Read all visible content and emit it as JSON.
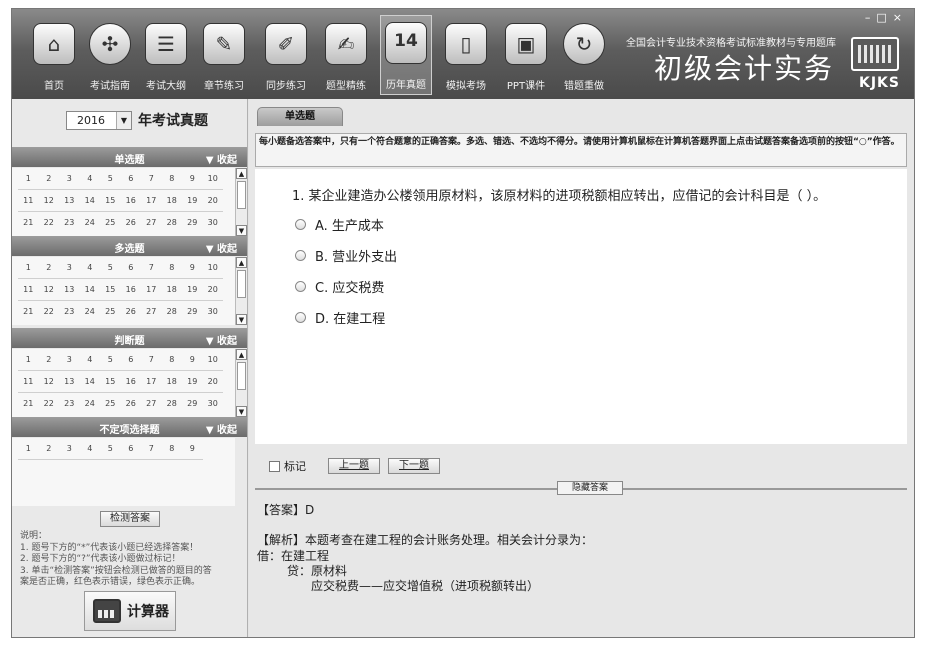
{
  "window": {
    "controls": [
      "–",
      "□",
      "×"
    ]
  },
  "toolbar": {
    "items": [
      {
        "label": "首页",
        "icon": "home-icon"
      },
      {
        "label": "考试指南",
        "icon": "compass-icon"
      },
      {
        "label": "考试大纲",
        "icon": "document-stack-icon"
      },
      {
        "label": "章节练习",
        "icon": "pen-list-icon"
      },
      {
        "label": "同步练习",
        "icon": "pencil-board-icon"
      },
      {
        "label": "题型精练",
        "icon": "notepad-pen-icon"
      },
      {
        "label": "历年真题",
        "icon": "calendar-14-icon",
        "glyph": "14"
      },
      {
        "label": "模拟考场",
        "icon": "door-icon"
      },
      {
        "label": "PPT课件",
        "icon": "ppt-icon"
      },
      {
        "label": "错题重做",
        "icon": "redo-icon"
      }
    ],
    "active_index": 6,
    "brand_subtitle": "全国会计专业技术资格考试标准教材与专用题库",
    "brand_title": "初级会计实务",
    "logo": "KJKS"
  },
  "left": {
    "year": "2016",
    "year_title": "年考试真题",
    "sections": [
      {
        "title": "单选题",
        "collapse": "▼ 收起",
        "rows": [
          [
            "1",
            "2",
            "3",
            "4",
            "5",
            "6",
            "7",
            "8",
            "9",
            "10"
          ],
          [
            "11",
            "12",
            "13",
            "14",
            "15",
            "16",
            "17",
            "18",
            "19",
            "20"
          ],
          [
            "21",
            "22",
            "23",
            "24",
            "25",
            "26",
            "27",
            "28",
            "29",
            "30"
          ]
        ]
      },
      {
        "title": "多选题",
        "collapse": "▼ 收起",
        "rows": [
          [
            "1",
            "2",
            "3",
            "4",
            "5",
            "6",
            "7",
            "8",
            "9",
            "10"
          ],
          [
            "11",
            "12",
            "13",
            "14",
            "15",
            "16",
            "17",
            "18",
            "19",
            "20"
          ],
          [
            "21",
            "22",
            "23",
            "24",
            "25",
            "26",
            "27",
            "28",
            "29",
            "30"
          ]
        ]
      },
      {
        "title": "判断题",
        "collapse": "▼ 收起",
        "rows": [
          [
            "1",
            "2",
            "3",
            "4",
            "5",
            "6",
            "7",
            "8",
            "9",
            "10"
          ],
          [
            "11",
            "12",
            "13",
            "14",
            "15",
            "16",
            "17",
            "18",
            "19",
            "20"
          ],
          [
            "21",
            "22",
            "23",
            "24",
            "25",
            "26",
            "27",
            "28",
            "29",
            "30"
          ]
        ]
      },
      {
        "title": "不定项选择题",
        "collapse": "▼ 收起",
        "rows": [
          [
            "1",
            "2",
            "3",
            "4",
            "5",
            "6",
            "7",
            "8",
            "9"
          ]
        ]
      }
    ],
    "check_button": "检测答案",
    "notes": [
      "说明：",
      "1. 题号下方的“*”代表该小题已经选择答案！",
      "2. 题号下方的“?”代表该小题做过标记！",
      "3. 单击“检测答案”按钮会检测已做答的题目的答",
      "案是否正确，红色表示错误，绿色表示正确。"
    ],
    "calculator": "计算器"
  },
  "main": {
    "tab": "单选题",
    "instruction": "每小题备选答案中，只有一个符合题意的正确答案。多选、错选、不选均不得分。请使用计算机鼠标在计算机答题界面上点击试题答案备选项前的按钮“○”作答。",
    "question": "1. 某企业建造办公楼领用原材料，该原材料的进项税额相应转出，应借记的会计科目是（ ）。",
    "options": [
      "A. 生产成本",
      "B. 营业外支出",
      "C. 应交税费",
      "D. 在建工程"
    ],
    "mark_label": "标记",
    "prev_button": "上一题",
    "next_button": "下一题",
    "hide_answer_button": "隐藏答案",
    "answer": "【答案】D",
    "analysis": "【解析】本题考查在建工程的会计账务处理。相关会计分录为：",
    "entries": [
      "借：在建工程",
      "贷：原材料",
      "应交税费——应交增值税（进项税额转出）"
    ]
  }
}
